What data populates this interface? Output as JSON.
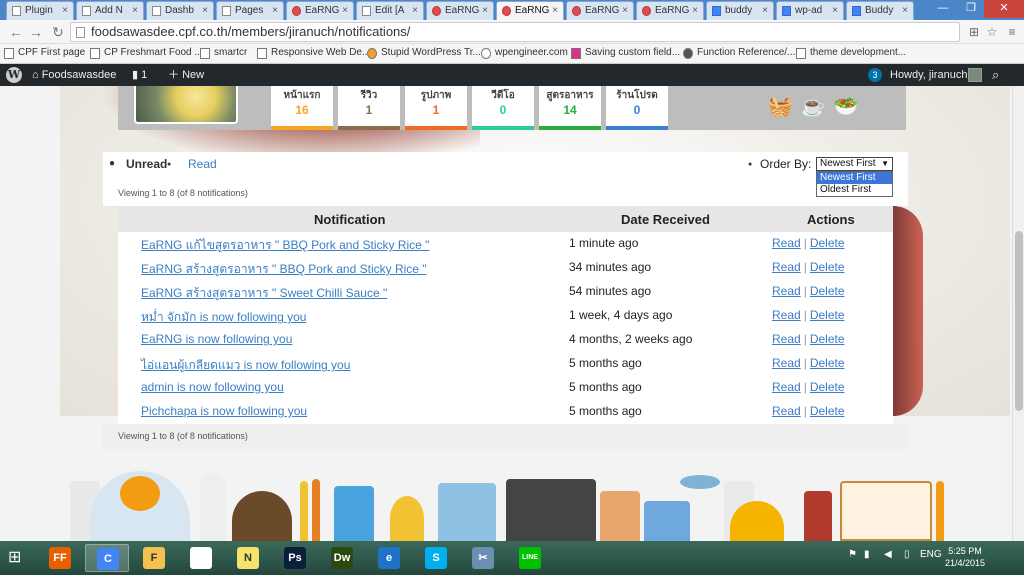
{
  "browser": {
    "tabs": [
      {
        "title": "Plugin",
        "icon": "page-icon",
        "active": false
      },
      {
        "title": "Add N",
        "icon": "page-icon",
        "active": false
      },
      {
        "title": "Dashb",
        "icon": "page-icon",
        "active": false
      },
      {
        "title": "Pages",
        "icon": "page-icon",
        "active": false
      },
      {
        "title": "EaRNG",
        "icon": "wp-icon",
        "active": false
      },
      {
        "title": "Edit [A",
        "icon": "page-icon",
        "active": false
      },
      {
        "title": "EaRNG",
        "icon": "wp-icon",
        "active": false
      },
      {
        "title": "EaRNG",
        "icon": "wp-icon",
        "active": true
      },
      {
        "title": "EaRNG",
        "icon": "wp-icon",
        "active": false
      },
      {
        "title": "EaRNG",
        "icon": "wp-icon",
        "active": false
      },
      {
        "title": "buddy",
        "icon": "google-icon",
        "active": false
      },
      {
        "title": "wp-ad",
        "icon": "google-icon",
        "active": false
      },
      {
        "title": "Buddy",
        "icon": "google-icon",
        "active": false
      }
    ],
    "url": "foodsawasdee.cpf.co.th/members/jiranuch/notifications/",
    "bookmarks": [
      "CPF First page",
      "CP Freshmart Food ...",
      "smartcr",
      "Responsive Web De...",
      "Stupid WordPress Tr...",
      "wpengineer.com",
      "Saving custom field...",
      "Function Reference/...",
      "theme development..."
    ]
  },
  "adminbar": {
    "site_name": "Foodsawasdee",
    "comments_count": "1",
    "new_label": "New",
    "notif_count": "3",
    "howdy": "Howdy, jiranuch"
  },
  "profile": {
    "stats": [
      {
        "label": "หน้าแรก",
        "value": "16",
        "color": "#f5a623"
      },
      {
        "label": "รีวิว",
        "value": "1",
        "color": "#8b6d4a"
      },
      {
        "label": "รูปภาพ",
        "value": "1",
        "color": "#f26a21"
      },
      {
        "label": "วีดีโอ",
        "value": "0",
        "color": "#2ecc9a"
      },
      {
        "label": "สูตรอาหาร",
        "value": "14",
        "color": "#27ae3c"
      },
      {
        "label": "ร้านโปรด",
        "value": "0",
        "color": "#3a7fd5"
      }
    ]
  },
  "notifications": {
    "tab_unread": "Unread",
    "tab_read": "Read",
    "order_by_label": "Order By:",
    "order_selected": "Newest First",
    "order_options": [
      "Newest First",
      "Oldest First"
    ],
    "viewing_text": "Viewing 1 to 8 (of 8 notifications)",
    "columns": {
      "notification": "Notification",
      "date": "Date Received",
      "actions": "Actions"
    },
    "read_label": "Read",
    "delete_label": "Delete",
    "separator": "|",
    "rows": [
      {
        "subject": "EaRNG แก้ไขสูตรอาหาร \" BBQ Pork and Sticky Rice \"",
        "date": "1 minute ago"
      },
      {
        "subject": "EaRNG สร้างสูตรอาหาร \" BBQ Pork and Sticky Rice \"",
        "date": "34 minutes ago"
      },
      {
        "subject": "EaRNG สร้างสูตรอาหาร \" Sweet Chilli Sauce \"",
        "date": "54 minutes ago"
      },
      {
        "subject": "หม่ำ จักมัก is now following you",
        "date": "1 week, 4 days ago"
      },
      {
        "subject": "EaRNG is now following you",
        "date": "4 months, 2 weeks ago"
      },
      {
        "subject": "ไอ่แอนผู้เกลียดแมว is now following you",
        "date": "5 months ago"
      },
      {
        "subject": "admin is now following you",
        "date": "5 months ago"
      },
      {
        "subject": "Pichchapa is now following you",
        "date": "5 months ago"
      }
    ]
  },
  "taskbar": {
    "apps": [
      {
        "name": "firefox-icon",
        "glyph": "FF",
        "color": "#e66000"
      },
      {
        "name": "chrome-icon",
        "glyph": "C",
        "color": "#4285f4"
      },
      {
        "name": "file-explorer-icon",
        "glyph": "F",
        "color": "#f2c14e"
      },
      {
        "name": "blank-document-icon",
        "glyph": "",
        "color": "#ffffff"
      },
      {
        "name": "sticky-notes-icon",
        "glyph": "N",
        "color": "#f7e36b"
      },
      {
        "name": "photoshop-icon",
        "glyph": "Ps",
        "color": "#0b1f3a"
      },
      {
        "name": "dreamweaver-icon",
        "glyph": "Dw",
        "color": "#2b4a10"
      },
      {
        "name": "internet-explorer-icon",
        "glyph": "e",
        "color": "#1e73c8"
      },
      {
        "name": "skype-icon",
        "glyph": "S",
        "color": "#00aff0"
      },
      {
        "name": "snipping-tool-icon",
        "glyph": "✂",
        "color": "#6b8fb3"
      },
      {
        "name": "line-icon",
        "glyph": "LINE",
        "color": "#00c300"
      }
    ],
    "language": "ENG",
    "time": "5:25 PM",
    "date": "21/4/2015"
  }
}
